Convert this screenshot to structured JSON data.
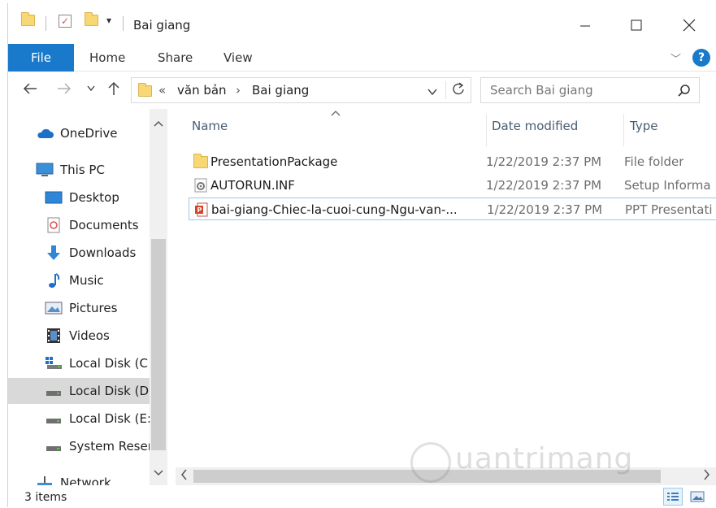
{
  "window": {
    "title": "Bai giang"
  },
  "ribbon": {
    "tabs": [
      "File",
      "Home",
      "Share",
      "View"
    ]
  },
  "address": {
    "overflow": "«",
    "segments": [
      "văn bản",
      "Bai giang"
    ]
  },
  "search": {
    "placeholder": "Search Bai giang"
  },
  "sidebar": {
    "items": [
      {
        "label": "OneDrive",
        "icon": "cloud-icon"
      },
      {
        "label": "This PC",
        "icon": "computer-icon"
      },
      {
        "label": "Desktop",
        "icon": "desktop-icon"
      },
      {
        "label": "Documents",
        "icon": "documents-icon"
      },
      {
        "label": "Downloads",
        "icon": "download-arrow-icon"
      },
      {
        "label": "Music",
        "icon": "music-note-icon"
      },
      {
        "label": "Pictures",
        "icon": "pictures-icon"
      },
      {
        "label": "Videos",
        "icon": "film-icon"
      },
      {
        "label": "Local Disk (C",
        "icon": "windows-drive-icon"
      },
      {
        "label": "Local Disk (D",
        "icon": "drive-icon"
      },
      {
        "label": "Local Disk (E:",
        "icon": "drive-icon"
      },
      {
        "label": "System Reser",
        "icon": "drive-icon"
      },
      {
        "label": "Network",
        "icon": "network-icon"
      }
    ]
  },
  "columns": {
    "name": "Name",
    "date": "Date modified",
    "type": "Type"
  },
  "files": [
    {
      "name": "PresentationPackage",
      "date": "1/22/2019 2:37 PM",
      "type": "File folder",
      "icon": "folder-icon"
    },
    {
      "name": "AUTORUN.INF",
      "date": "1/22/2019 2:37 PM",
      "type": "Setup Informa",
      "icon": "settings-file-icon"
    },
    {
      "name": "bai-giang-Chiec-la-cuoi-cung-Ngu-van-...",
      "date": "1/22/2019 2:37 PM",
      "type": "PPT Presentati",
      "icon": "powerpoint-icon"
    }
  ],
  "status": {
    "items_count": "3 items"
  },
  "watermark": "uantrimang",
  "colors": {
    "accent": "#1979ca",
    "selected": "#d9d9d9",
    "focus_border": "#99c9ef"
  }
}
